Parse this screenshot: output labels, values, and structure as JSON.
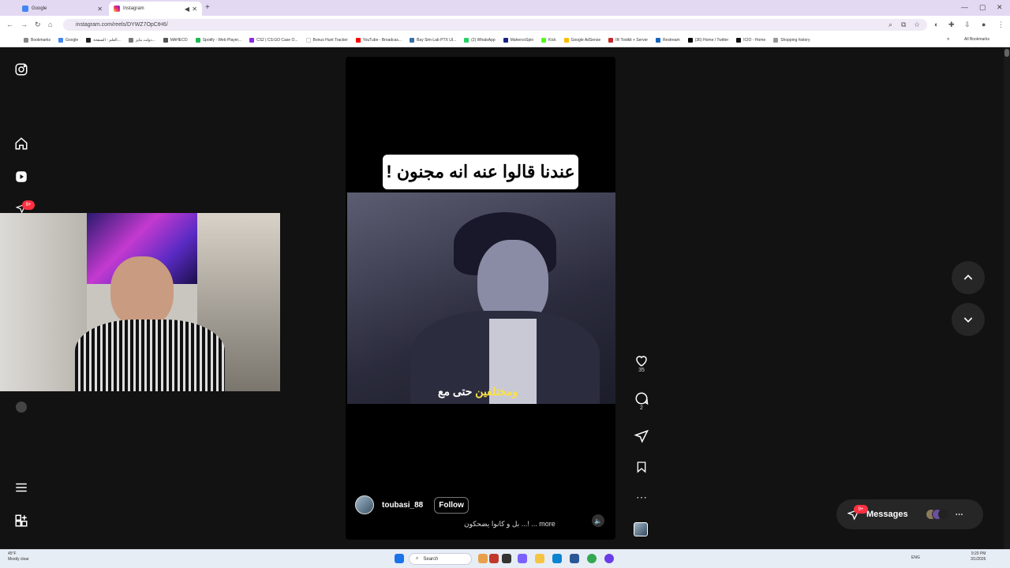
{
  "browser": {
    "tabs": [
      {
        "title": "Google",
        "active": false
      },
      {
        "title": "Instagram",
        "active": true
      }
    ],
    "url": "instagram.com/reels/DYWZ7OpCtH6/",
    "bookmarks": [
      "Bookmarks",
      "Google",
      "العلم - الصفحة...",
      "دولت مايز...",
      "MAHECO",
      "Spotify - Web Player...",
      "CS2 | CS:GO Case O...",
      "Bonus Hunt Tracker",
      "YouTube - Broadcas...",
      "Bay Sim-Lab PTX Ul...",
      "(2) WhatsApp",
      "MahercoSpin",
      "Kick",
      "Google AdSense",
      "IR Toolkit + Server",
      "Restream",
      "(36) Home / Twitter",
      "ICIO - Home",
      "Shopping history"
    ],
    "all_bookmarks_label": "All Bookmarks"
  },
  "sidebar": {
    "notification_badge": "9+"
  },
  "reel": {
    "caption_text": "عندنا قالوا عنه انه مجنون !",
    "subtitle_white": "حتى مع",
    "subtitle_yellow": "ومختلفين",
    "username": "toubasi_88",
    "follow_label": "Follow",
    "description": "بل و كانوا يضحكون ...! ... more",
    "likes": "35",
    "comments": "2"
  },
  "messages": {
    "label": "Messages",
    "badge": "9+"
  },
  "taskbar": {
    "weather_temp": "45°F",
    "weather_desc": "Mostly clear",
    "search_placeholder": "Search",
    "lang": "ENG",
    "time": "9:20 PM",
    "date": "3/1/2026"
  },
  "colors": {
    "accent_badge": "#ff3040",
    "page_bg": "#121212",
    "subtitle_yellow": "#f8e14a"
  }
}
